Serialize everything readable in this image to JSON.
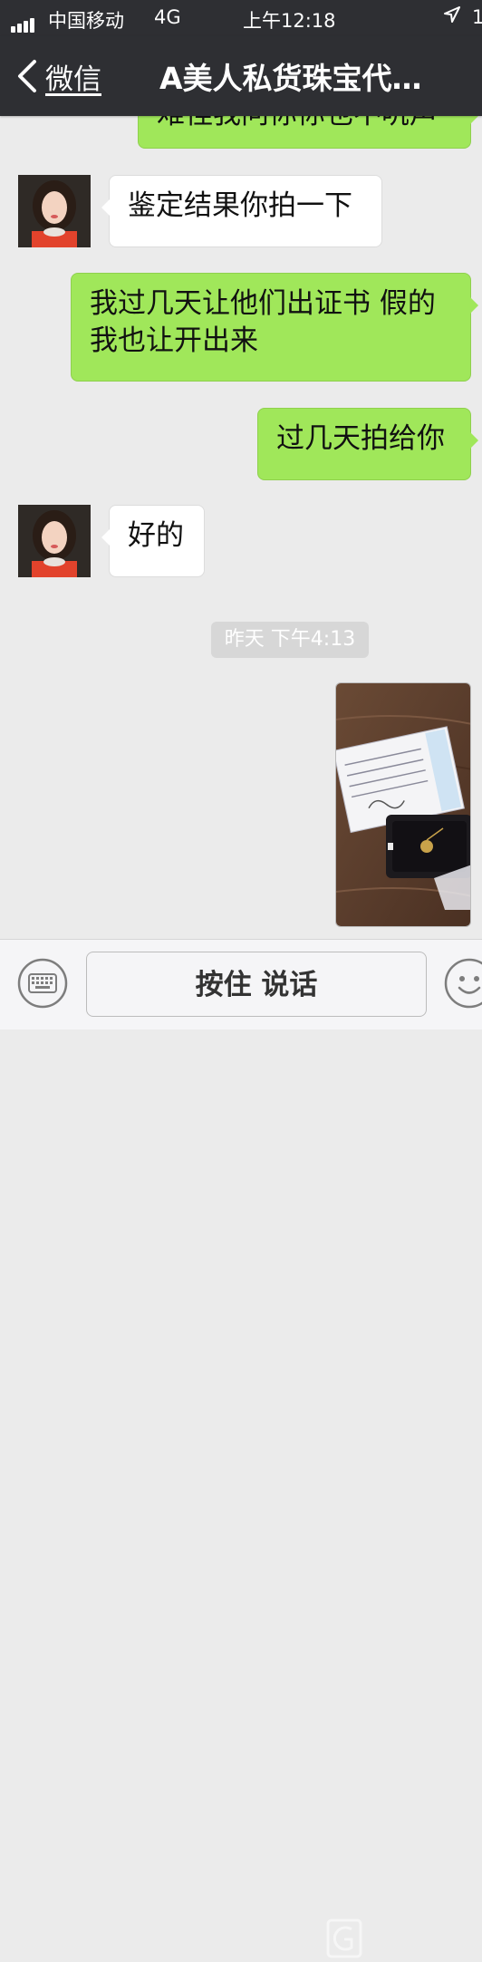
{
  "status_bar": {
    "carrier": "中国移动",
    "network": "4G",
    "time": "上午12:18",
    "battery": "1"
  },
  "nav": {
    "back_label": "微信",
    "title": "A美人私货珠宝代…"
  },
  "chat": {
    "partial_message": "难怪我问你你也不吭声",
    "messages": [
      {
        "from": "them",
        "text": "鉴定结果你拍一下"
      },
      {
        "from": "me",
        "line1": "我过几天让他们出证书 假的",
        "line2": "我也让开出来"
      },
      {
        "from": "me",
        "text": "过几天拍给你"
      },
      {
        "from": "them",
        "text": "好的"
      }
    ],
    "timestamp": "昨天 下午4:13"
  },
  "input_bar": {
    "hold_to_talk": "按住 说话"
  },
  "colors": {
    "header_bg": "#2e2f33",
    "chat_bg": "#ebebeb",
    "out_bubble": "#a0e75a",
    "in_bubble": "#ffffff"
  },
  "icons": [
    "signal-icon",
    "location-arrow-icon",
    "back-chevron-icon",
    "keyboard-icon",
    "emoji-icon"
  ]
}
